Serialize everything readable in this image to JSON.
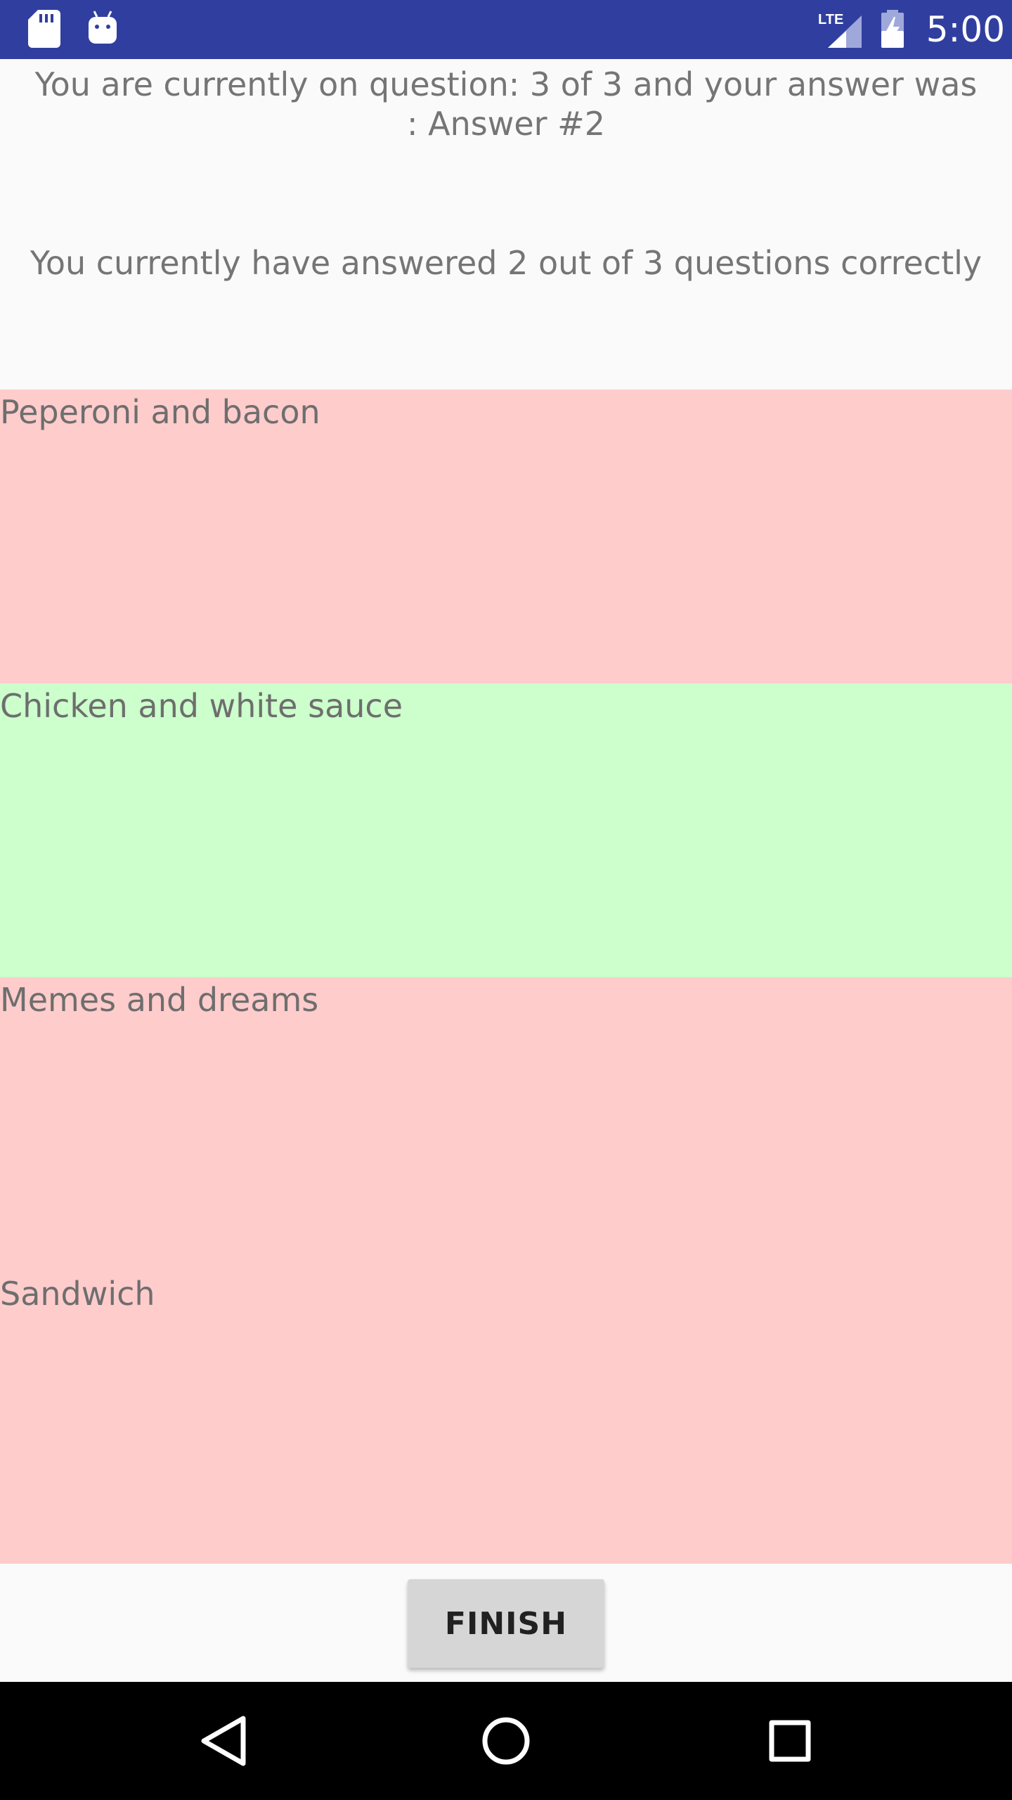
{
  "status_bar": {
    "time": "5:00",
    "network_label": "LTE",
    "icons": [
      "sd-card-icon",
      "android-icon",
      "lte-signal-icon",
      "battery-charging-icon"
    ]
  },
  "quiz": {
    "question_status": "You are currently on question: 3 of 3 and your answer was : Answer #2",
    "score_status": "You currently have answered 2 out of 3 questions correctly",
    "answers": [
      {
        "label": "Peperoni and bacon",
        "state": "wrong"
      },
      {
        "label": "Chicken and white sauce",
        "state": "correct"
      },
      {
        "label": "Memes and dreams",
        "state": "wrong"
      },
      {
        "label": "Sandwich",
        "state": "wrong"
      }
    ],
    "finish_label": "FINISH"
  },
  "colors": {
    "status_bar": "#303f9f",
    "wrong_answer": "#ffcccc",
    "correct_answer": "#ccffcc",
    "button": "#d6d6d6",
    "nav_bar": "#000000"
  },
  "nav_bar": {
    "buttons": [
      "back-icon",
      "home-icon",
      "recents-icon"
    ]
  }
}
